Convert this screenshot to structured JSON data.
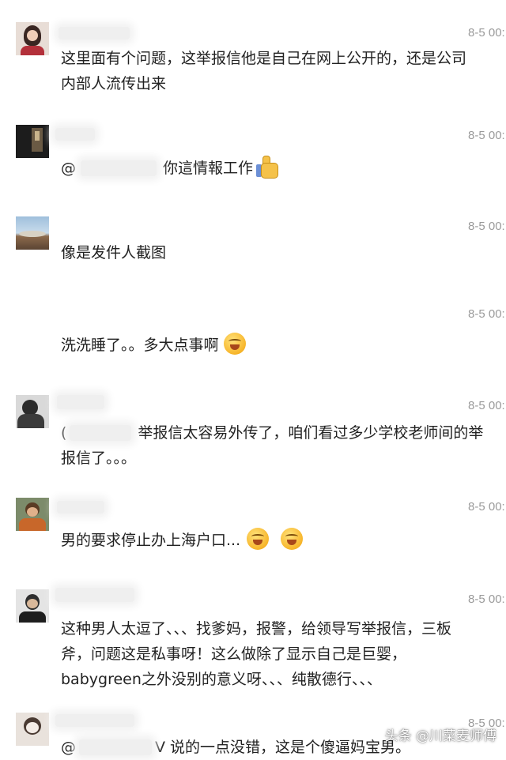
{
  "comments": [
    {
      "time": "8-5 00:",
      "lines": [
        "这里面有个问题，这举报信他是自己在网上公开的，还是公司",
        "内部人流传出来"
      ]
    },
    {
      "time": "8-5 00:",
      "prefix": "@",
      "text": "你這情報工作",
      "emoji": "thumbs-up-icon"
    },
    {
      "time": "8-5 00:",
      "text": "像是发件人截图"
    },
    {
      "time": "8-5 00:",
      "text": "洗洗睡了。。多大点事啊",
      "emoji": "laugh-cry-icon"
    },
    {
      "time": "8-5 00:",
      "prefix": "(",
      "lines": [
        "举报信太容易外传了，咱们看过多少学校老师间的举",
        "报信了。。。"
      ]
    },
    {
      "time": "8-5 00:",
      "text": "男的要求停止办上海户口...",
      "emoji": "laugh-cry-icon"
    },
    {
      "time": "8-5 00:",
      "lines": [
        "这种男人太逗了、、、找爹妈，报警，给领导写举报信，三板",
        "斧，问题这是私事呀！这么做除了显示自己是巨婴，",
        "babygreen之外没别的意义呀、、、纯散德行、、、"
      ]
    },
    {
      "time": "8-5 00:",
      "prefix": "@",
      "text": "V 说的一点没错，这是个傻逼妈宝男。"
    }
  ],
  "watermark": "头条 @川菜麦师傅"
}
